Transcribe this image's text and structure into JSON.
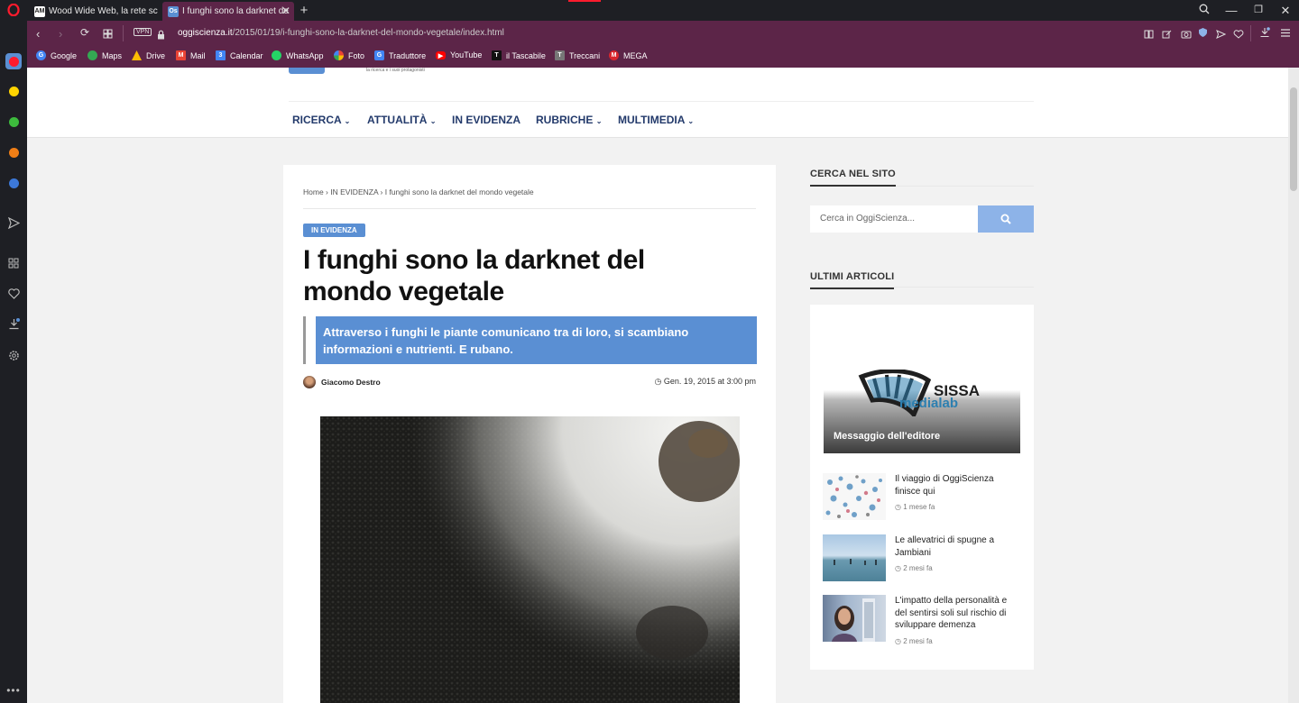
{
  "browser": {
    "tabs": [
      {
        "label": "Wood Wide Web, la rete sc",
        "favicon": "AM",
        "active": false
      },
      {
        "label": "I funghi sono la darknet de",
        "favicon": "Os",
        "active": true
      }
    ],
    "new_tab": "+",
    "url": {
      "domain": "oggiscienza.it",
      "path": "/2015/01/19/i-funghi-sono-la-darknet-del-mondo-vegetale/index.html"
    },
    "vpn_label": "VPN",
    "bookmarks": [
      {
        "label": "Google",
        "color": "#4285f4",
        "glyph": "G"
      },
      {
        "label": "Maps",
        "color": "#34a853",
        "glyph": ""
      },
      {
        "label": "Drive",
        "color": "#fbbc04",
        "glyph": ""
      },
      {
        "label": "Mail",
        "color": "#ea4335",
        "glyph": "M"
      },
      {
        "label": "Calendar",
        "color": "#4285f4",
        "glyph": "31"
      },
      {
        "label": "WhatsApp",
        "color": "#25d366",
        "glyph": ""
      },
      {
        "label": "Foto",
        "color": "#fbbc04",
        "glyph": ""
      },
      {
        "label": "Traduttore",
        "color": "#4285f4",
        "glyph": "G"
      },
      {
        "label": "YouTube",
        "color": "#ff0000",
        "glyph": ""
      },
      {
        "label": "il Tascabile",
        "color": "#111111",
        "glyph": "T"
      },
      {
        "label": "Treccani",
        "color": "#777777",
        "glyph": "T"
      },
      {
        "label": "MEGA",
        "color": "#d9272e",
        "glyph": "M"
      }
    ],
    "sidebar_colors": [
      "#ffd400",
      "#3dbb3d",
      "#f07e16",
      "#3c78d8"
    ]
  },
  "site": {
    "tagline": "la ricerca e i suoi protagonisti",
    "menu": [
      {
        "label": "RICERCA",
        "dropdown": true
      },
      {
        "label": "ATTUALITÀ",
        "dropdown": true
      },
      {
        "label": "IN EVIDENZA",
        "dropdown": false
      },
      {
        "label": "RUBRICHE",
        "dropdown": true
      },
      {
        "label": "MULTIMEDIA",
        "dropdown": true
      }
    ]
  },
  "article": {
    "breadcrumb": {
      "home": "Home",
      "section": "IN EVIDENZA",
      "current": "I funghi sono la darknet del mondo vegetale"
    },
    "category": "IN EVIDENZA",
    "title_line1": "I funghi sono la darknet del",
    "title_line2": "mondo vegetale",
    "subtitle_line1": "Attraverso i funghi le piante comunicano tra di loro, si scambiano",
    "subtitle_line2": "informazioni e nutrienti. E rubano.",
    "author": "Giacomo Destro",
    "date": "Gen. 19, 2015 at 3:00 pm"
  },
  "sidebar": {
    "search_title": "CERCA NEL SITO",
    "search_placeholder": "Cerca in OggiScienza...",
    "latest_title": "ULTIMI ARTICOLI",
    "featured": {
      "logo_text": "SISSA",
      "logo_sub": "medialab",
      "caption": "Messaggio dell'editore"
    },
    "posts": [
      {
        "title": "Il viaggio di OggiScienza finisce qui",
        "date": "1 mese fa"
      },
      {
        "title": "Le allevatrici di spugne a Jambiani",
        "date": "2 mesi fa"
      },
      {
        "title": "L'impatto della personalità e del sentirsi soli sul rischio di sviluppare demenza",
        "date": "2 mesi fa"
      }
    ]
  },
  "colors": {
    "accent": "#5a8fd3",
    "browser_bar": "#5c2548",
    "menu_text": "#233a6b"
  }
}
